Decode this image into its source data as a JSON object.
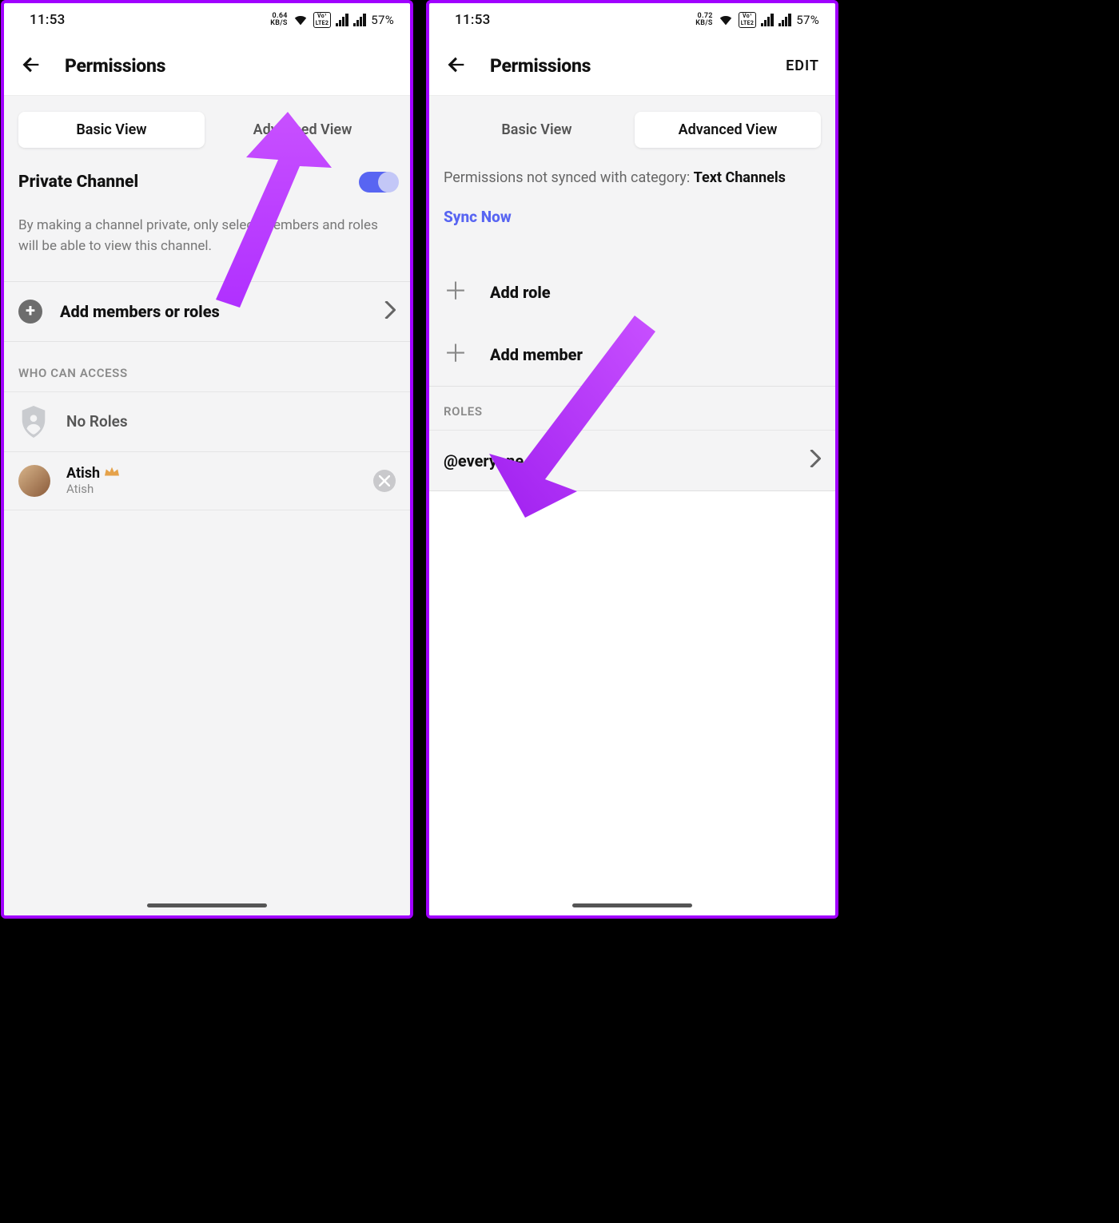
{
  "left": {
    "status": {
      "time": "11:53",
      "kbs_top": "0.64",
      "kbs_bot": "KB/S",
      "battery": "57%"
    },
    "header": {
      "title": "Permissions"
    },
    "tabs": {
      "basic": "Basic View",
      "advanced": "Advanced View"
    },
    "private": {
      "label": "Private Channel",
      "desc": "By making a channel private, only select members and roles will be able to view this channel."
    },
    "add_members": "Add members or roles",
    "who_can_access": "WHO CAN ACCESS",
    "no_roles": "No Roles",
    "member": {
      "name": "Atish",
      "sub": "Atish"
    }
  },
  "right": {
    "status": {
      "time": "11:53",
      "kbs_top": "0.72",
      "kbs_bot": "KB/S",
      "battery": "57%"
    },
    "header": {
      "title": "Permissions",
      "edit": "EDIT"
    },
    "tabs": {
      "basic": "Basic View",
      "advanced": "Advanced View"
    },
    "sync": {
      "text": "Permissions not synced with category: ",
      "category": "Text Channels",
      "link": "Sync Now"
    },
    "add_role": "Add role",
    "add_member": "Add member",
    "roles_label": "ROLES",
    "everyone": "@everyone"
  }
}
